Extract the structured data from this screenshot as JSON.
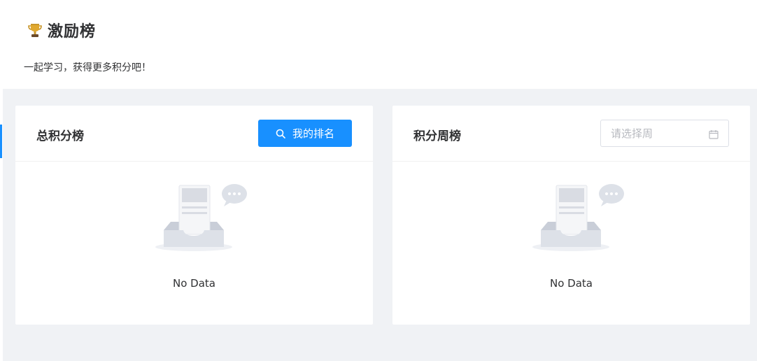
{
  "header": {
    "title": "激励榜",
    "subtitle": "一起学习，获得更多积分吧！"
  },
  "total_board": {
    "title": "总积分榜",
    "rank_button_label": "我的排名",
    "empty_text": "No Data"
  },
  "weekly_board": {
    "title": "积分周榜",
    "week_placeholder": "请选择周",
    "empty_text": "No Data"
  },
  "icons": {
    "title_icon": "trophy-icon",
    "rank_button_icon": "search-icon",
    "week_picker_icon": "calendar-icon",
    "empty_icon": "empty-inbox-icon"
  },
  "colors": {
    "primary": "#1890ff",
    "background": "#f0f2f5",
    "trophy": "#d4a017"
  }
}
